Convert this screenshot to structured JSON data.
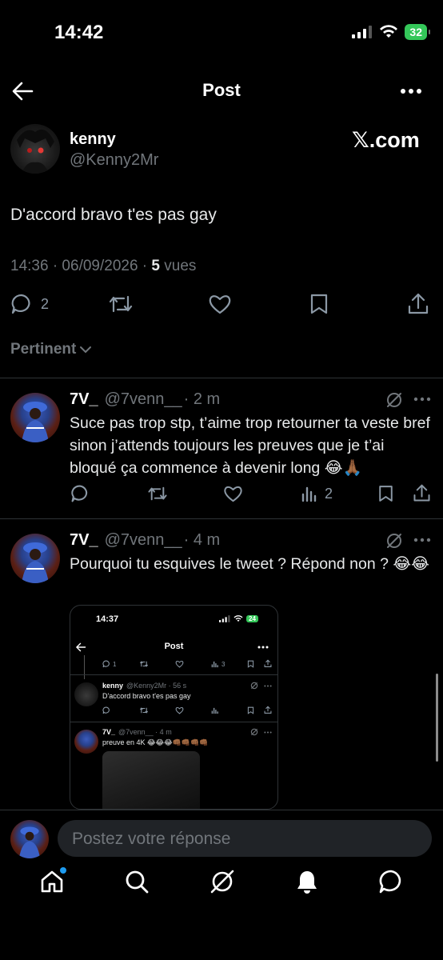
{
  "status_bar": {
    "time": "14:42",
    "battery": "32"
  },
  "header": {
    "title": "Post"
  },
  "post": {
    "author_name": "kenny",
    "author_handle": "@Kenny2Mr",
    "source_badge": "𝕏.com",
    "text": "D'accord bravo t'es pas gay",
    "timestamp": "14:36 · 06/09/2026 · ",
    "views_count": "5",
    "views_label": " vues",
    "reply_count": "2"
  },
  "sort": {
    "label": "Pertinent"
  },
  "replies": [
    {
      "name": "7V_",
      "handle": "@7venn__",
      "time": "· 2 m",
      "text": "Suce pas trop stp, t’aime trop retourner ta veste bref sinon j’attends toujours les preuves que je t’ai bloqué ça commence à devenir long 😂🙏🏾",
      "views": "2"
    },
    {
      "name": "7V_",
      "handle": "@7venn__",
      "time": "· 4 m",
      "text": "Pourquoi tu esquives le tweet ? Répond non ? 😂😂"
    }
  ],
  "embed": {
    "time": "14:37",
    "battery": "24",
    "title": "Post",
    "reply_count": "1",
    "views": "3",
    "post_name": "kenny",
    "post_handle": "@Kenny2Mr · 56 s",
    "post_text": "D'accord bravo t'es pas gay",
    "reply_name": "7V_",
    "reply_handle": "@7venn__ · 4 m",
    "reply_text": "preuve en 4K 😂😂😂👊🏾👊🏾👊🏾👊🏾"
  },
  "composer": {
    "placeholder": "Postez votre réponse"
  },
  "colors": {
    "accent": "#1d9bf0",
    "battery": "#34c759",
    "muted": "#71767b"
  }
}
